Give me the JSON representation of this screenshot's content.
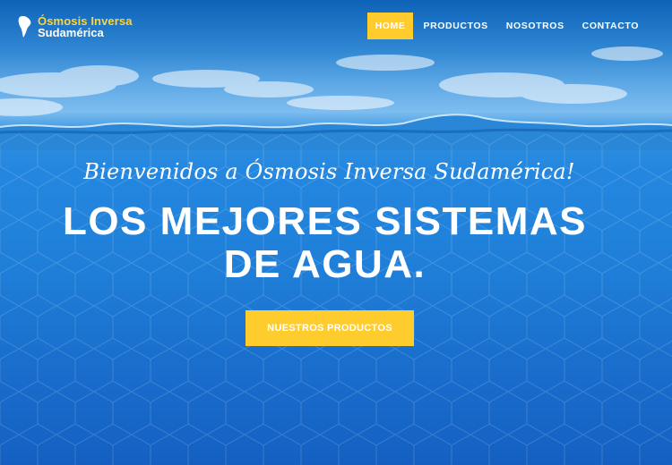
{
  "brand": {
    "line1": "Ósmosis Inversa",
    "line2": "Sudamérica",
    "logo_icon": "south-america-map-icon",
    "accent_color": "#ffcc2e"
  },
  "nav": {
    "items": [
      {
        "label": "HOME",
        "active": true
      },
      {
        "label": "PRODUCTOS",
        "active": false
      },
      {
        "label": "NOSOTROS",
        "active": false
      },
      {
        "label": "CONTACTO",
        "active": false
      }
    ]
  },
  "hero": {
    "subtitle": "Bienvenidos a Ósmosis Inversa Sudamérica!",
    "title_line1": "LOS MEJORES SISTEMAS",
    "title_line2": "DE AGUA.",
    "cta_label": "NUESTROS PRODUCTOS"
  }
}
